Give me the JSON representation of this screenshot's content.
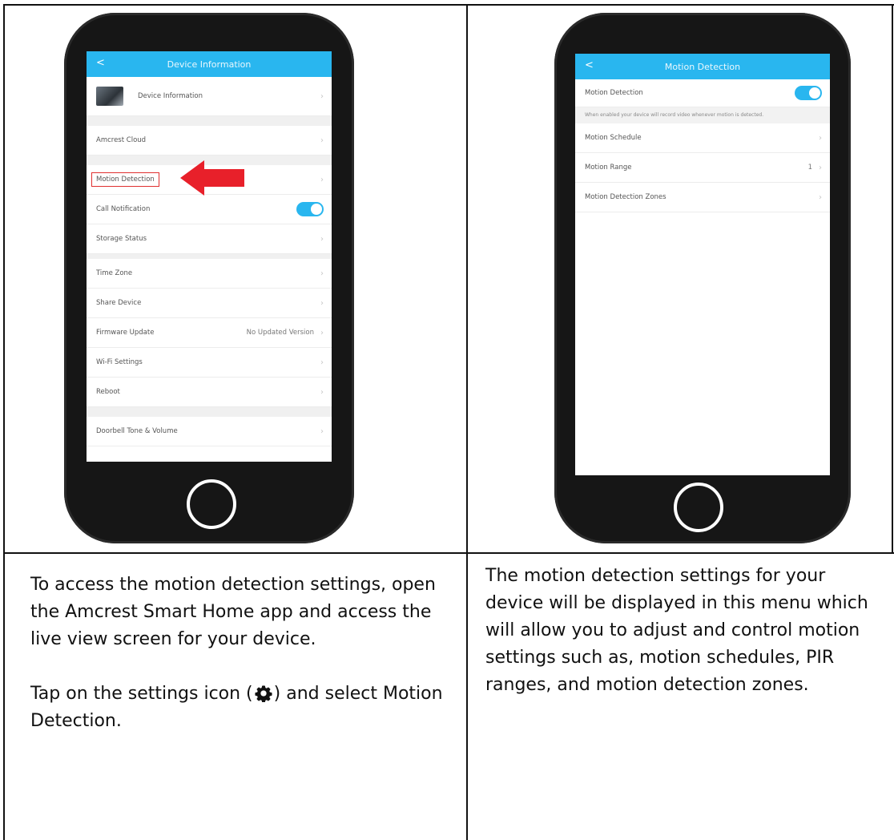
{
  "left_phone": {
    "screen_title": "Device Information",
    "back_glyph": "<",
    "rows": [
      {
        "label": "Device Information",
        "type": "device"
      },
      {
        "label": "Amcrest Cloud",
        "type": "row"
      },
      {
        "label": "Motion Detection",
        "type": "highlight"
      },
      {
        "label": "Call Notification",
        "type": "toggle"
      },
      {
        "label": "Storage Status",
        "type": "row"
      },
      {
        "label": "Time Zone",
        "type": "row"
      },
      {
        "label": "Share Device",
        "type": "row"
      },
      {
        "label": "Firmware Update",
        "type": "value",
        "value": "No Updated Version"
      },
      {
        "label": "Wi-Fi Settings",
        "type": "row"
      },
      {
        "label": "Reboot",
        "type": "row"
      },
      {
        "label": "Doorbell Tone & Volume",
        "type": "row"
      }
    ],
    "arrow_color": "#e8202a"
  },
  "right_phone": {
    "screen_title": "Motion Detection",
    "back_glyph": "<",
    "motion_detection_label": "Motion Detection",
    "hint": "When enabled your device will record video whenever motion is detected.",
    "rows": [
      {
        "label": "Motion Schedule"
      },
      {
        "label": "Motion Range",
        "value": "1"
      },
      {
        "label": "Motion Detection Zones"
      }
    ]
  },
  "captions": {
    "left_p1": "To access the motion detection settings, open the Amcrest Smart Home app and access the live view screen for your device.",
    "left_p2_before": "Tap on the settings icon (",
    "left_p2_after": ") and select Motion Detection.",
    "right_p1": "The motion detection settings for your device will be displayed in this menu which will allow you to adjust and control motion settings such as, motion schedules, PIR ranges, and motion detection zones."
  },
  "colors": {
    "accent": "#29b6ef",
    "phone_body": "#161616",
    "highlight": "#e03030"
  },
  "icons": {
    "chevron": "chevron-right-icon",
    "gear": "gear-icon",
    "arrow": "red-arrow-icon"
  }
}
